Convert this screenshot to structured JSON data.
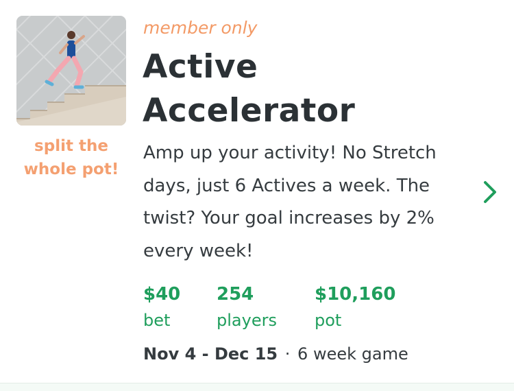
{
  "game": {
    "tag": "member only",
    "title": "Active Accelerator",
    "pot_note": "split the whole pot!",
    "description": "Amp up your activity! No Stretch days, just 6 Actives a week. The twist? Your goal increases by 2% every week!",
    "stats": [
      {
        "value": "$40",
        "label": "bet"
      },
      {
        "value": "254",
        "label": "players"
      },
      {
        "value": "$10,160",
        "label": "pot"
      }
    ],
    "date_range": "Nov 4 - Dec 15",
    "separator": "·",
    "duration": "6 week game"
  },
  "icons": {
    "thumbnail": "woman-running-up-stairs-photo",
    "chevron": "chevron-right-icon"
  },
  "colors": {
    "accent_orange": "#f39a66",
    "accent_green": "#1f9e5c",
    "title_text": "#2b3135"
  }
}
